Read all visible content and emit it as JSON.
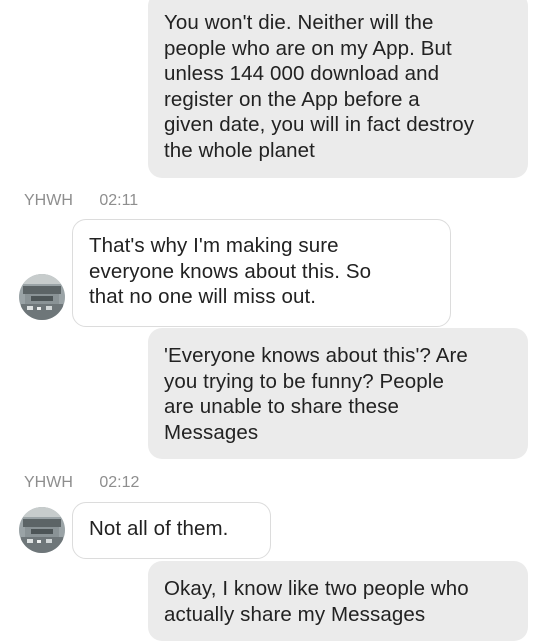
{
  "colors": {
    "outgoing_bubble": "#ebebeb",
    "incoming_bubble": "#ffffff",
    "incoming_border": "#dcdcdc",
    "meta_text": "#8e8e8e",
    "message_text": "#222222"
  },
  "messages": [
    {
      "direction": "outgoing",
      "text": "You won't die. Neither will the\npeople who are on my App. But\nunless 144 000 download and\nregister on the App before a\ngiven date, you will in fact destroy\nthe whole planet"
    },
    {
      "direction": "incoming",
      "sender": "YHWH",
      "time": "02:11",
      "avatar_icon": "avatar-photo-icon",
      "text": "That's why I'm making sure\neveryone knows about this. So\nthat no one will miss out."
    },
    {
      "direction": "outgoing",
      "text": "'Everyone knows about this'? Are\nyou trying to be funny? People\nare unable to share these\nMessages"
    },
    {
      "direction": "incoming",
      "sender": "YHWH",
      "time": "02:12",
      "avatar_icon": "avatar-photo-icon",
      "text": "Not all of them."
    },
    {
      "direction": "outgoing",
      "text": "Okay, I know like two people who\nactually share my Messages"
    }
  ]
}
